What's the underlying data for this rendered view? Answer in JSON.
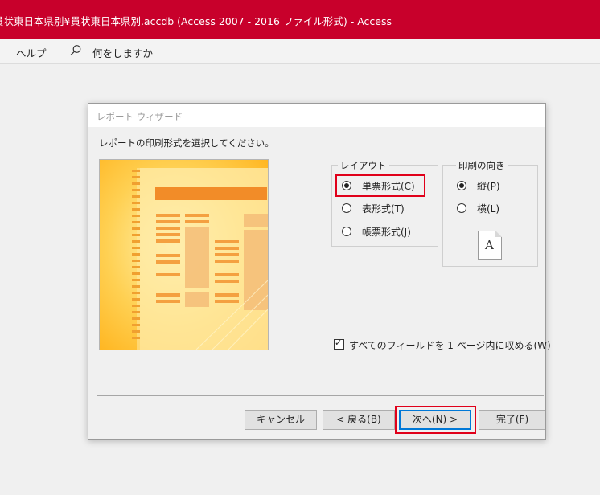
{
  "titlebar": {
    "title": "貫状東日本県別¥貫状東日本県別.accdb (Access 2007 - 2016 ファイル形式)  -  Access"
  },
  "ribbon": {
    "help": "ヘルプ",
    "tell_me": "何をしますか"
  },
  "dialog": {
    "title": "レポート ウィザード",
    "instruction": "レポートの印刷形式を選択してください。",
    "layout": {
      "legend": "レイアウト",
      "options": [
        "単票形式(C)",
        "表形式(T)",
        "帳票形式(J)"
      ],
      "selected": "単票形式(C)"
    },
    "orientation": {
      "legend": "印刷の向き",
      "options": [
        "縦(P)",
        "横(L)"
      ],
      "selected": "縦(P)",
      "page_letter": "A"
    },
    "fit_fields": {
      "label": "すべてのフィールドを 1 ページ内に収める(W)",
      "checked": true,
      "mark": "✓"
    },
    "buttons": {
      "cancel": "キャンセル",
      "back": "< 戻る(B)",
      "next": "次へ(N) >",
      "finish": "完了(F)"
    }
  },
  "colors": {
    "titlebar": "#c8002b",
    "highlight": "#e0001a",
    "default_button_border": "#0078d7",
    "preview_background": "#ffc640",
    "preview_page": "#ffe9a0",
    "preview_bar": "#f28c28"
  },
  "icons": {
    "search": "magnifier-icon",
    "page": "page-icon"
  }
}
